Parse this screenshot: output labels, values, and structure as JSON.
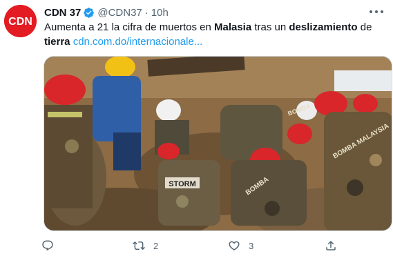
{
  "author": {
    "name": "CDN 37",
    "handle": "@CDN37",
    "time": "10h",
    "avatar_text": "CDN",
    "verified_color": "#1d9bf0"
  },
  "tweet": {
    "text_parts": [
      {
        "text": "Aumenta a 21 la cifra de muertos en ",
        "bold": false
      },
      {
        "text": "Malasia",
        "bold": true
      },
      {
        "text": " tras un ",
        "bold": false
      },
      {
        "text": "deslizamiento",
        "bold": true
      },
      {
        "text": " de ",
        "bold": false
      },
      {
        "text": "tierra",
        "bold": true
      },
      {
        "text": " ",
        "bold": false
      }
    ],
    "link_text": "cdn.com.do/internacionale..."
  },
  "media": {
    "vest_labels": [
      "STORM",
      "BOMBA",
      "BOMBA",
      "BOMBA MALAYSIA"
    ]
  },
  "actions": {
    "reply_count": "",
    "retweet_count": "2",
    "like_count": "3"
  },
  "colors": {
    "accent": "#1d9bf0",
    "text_secondary": "#536471",
    "brand_red": "#e31b23"
  }
}
